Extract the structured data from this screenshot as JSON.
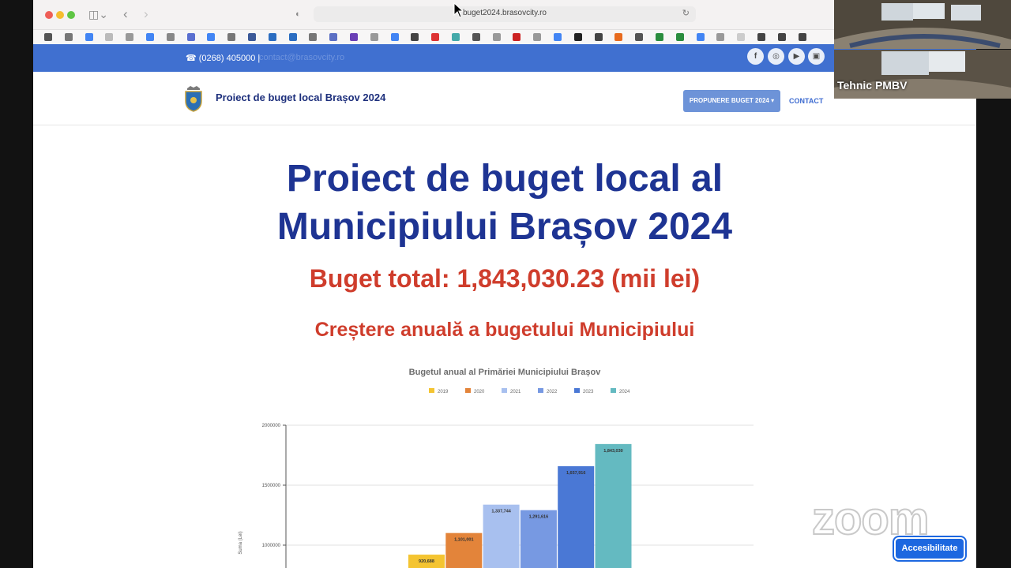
{
  "browser": {
    "url": "buget2024.brasovcity.ro"
  },
  "topbar": {
    "phone": "☎ (0268) 405000 |",
    "email": "contact@brasovcity.ro",
    "social": [
      "f",
      "◎",
      "▶",
      "▣"
    ]
  },
  "header": {
    "title": "Proiect de buget local Brașov 2024",
    "nav_dropdown": "PROPUNERE BUGET 2024 ▾",
    "nav_contact": "CONTACT"
  },
  "main": {
    "heading_line1": "Proiect de buget local al",
    "heading_line2": "Municipiului Brașov 2024",
    "total": "Buget total: 1,843,030.23 (mii lei)",
    "subtitle": "Creștere anuală a bugetului Municipiului"
  },
  "chart_data": {
    "type": "bar",
    "title": "Bugetul anual al Primăriei Municipiului Brașov",
    "ylabel": "Suma (Lei)",
    "legend_position": "top",
    "grid": true,
    "ylim": [
      800000,
      2000000
    ],
    "yticks": [
      "2000000",
      "1500000",
      "1000000"
    ],
    "series": [
      {
        "name": "2019",
        "value": 920688,
        "label": "920,688",
        "color": "#f4c431"
      },
      {
        "name": "2020",
        "value": 1101001,
        "label": "1,101,001",
        "color": "#e3843a"
      },
      {
        "name": "2021",
        "value": 1337744,
        "label": "1,337,744",
        "color": "#a8c0ef"
      },
      {
        "name": "2022",
        "value": 1291616,
        "label": "1,291,616",
        "color": "#7799e2"
      },
      {
        "name": "2023",
        "value": 1657916,
        "label": "1,657,916",
        "color": "#4a78d5"
      },
      {
        "name": "2024",
        "value": 1843030,
        "label": "1,843,030",
        "color": "#64bac1"
      }
    ]
  },
  "overlay": {
    "participant": "Tehnic PMBV",
    "watermark": "zoom",
    "accessibility": "Accesibilitate"
  }
}
